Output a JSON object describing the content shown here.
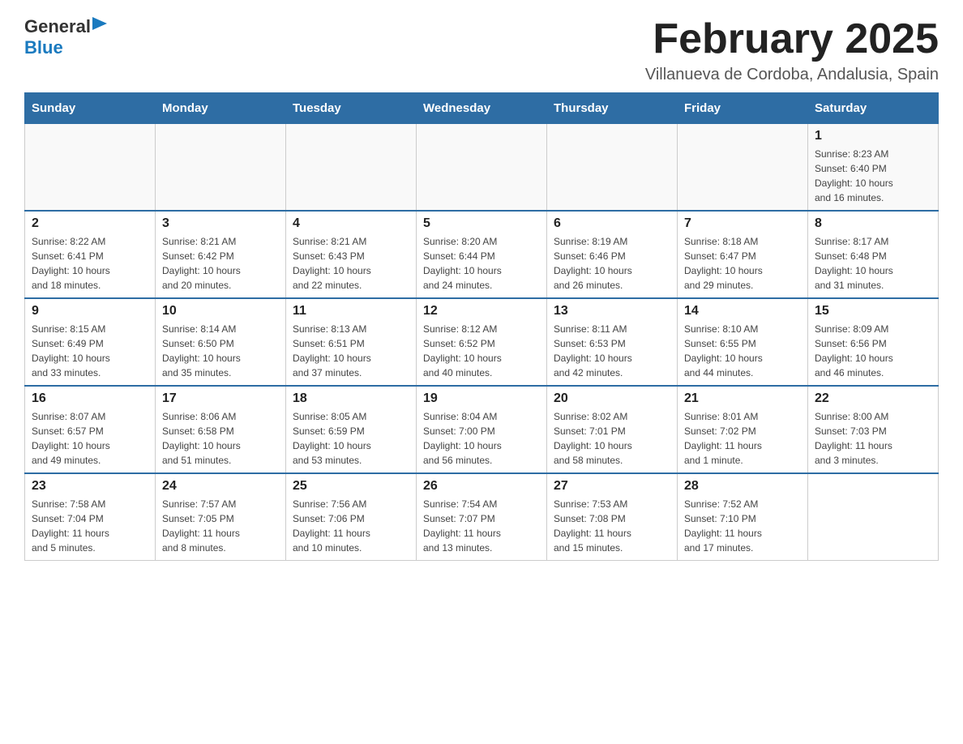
{
  "header": {
    "logo_general": "General",
    "logo_blue": "Blue",
    "title": "February 2025",
    "location": "Villanueva de Cordoba, Andalusia, Spain"
  },
  "days_of_week": [
    "Sunday",
    "Monday",
    "Tuesday",
    "Wednesday",
    "Thursday",
    "Friday",
    "Saturday"
  ],
  "weeks": [
    {
      "days": [
        {
          "num": "",
          "info": ""
        },
        {
          "num": "",
          "info": ""
        },
        {
          "num": "",
          "info": ""
        },
        {
          "num": "",
          "info": ""
        },
        {
          "num": "",
          "info": ""
        },
        {
          "num": "",
          "info": ""
        },
        {
          "num": "1",
          "info": "Sunrise: 8:23 AM\nSunset: 6:40 PM\nDaylight: 10 hours\nand 16 minutes."
        }
      ]
    },
    {
      "days": [
        {
          "num": "2",
          "info": "Sunrise: 8:22 AM\nSunset: 6:41 PM\nDaylight: 10 hours\nand 18 minutes."
        },
        {
          "num": "3",
          "info": "Sunrise: 8:21 AM\nSunset: 6:42 PM\nDaylight: 10 hours\nand 20 minutes."
        },
        {
          "num": "4",
          "info": "Sunrise: 8:21 AM\nSunset: 6:43 PM\nDaylight: 10 hours\nand 22 minutes."
        },
        {
          "num": "5",
          "info": "Sunrise: 8:20 AM\nSunset: 6:44 PM\nDaylight: 10 hours\nand 24 minutes."
        },
        {
          "num": "6",
          "info": "Sunrise: 8:19 AM\nSunset: 6:46 PM\nDaylight: 10 hours\nand 26 minutes."
        },
        {
          "num": "7",
          "info": "Sunrise: 8:18 AM\nSunset: 6:47 PM\nDaylight: 10 hours\nand 29 minutes."
        },
        {
          "num": "8",
          "info": "Sunrise: 8:17 AM\nSunset: 6:48 PM\nDaylight: 10 hours\nand 31 minutes."
        }
      ]
    },
    {
      "days": [
        {
          "num": "9",
          "info": "Sunrise: 8:15 AM\nSunset: 6:49 PM\nDaylight: 10 hours\nand 33 minutes."
        },
        {
          "num": "10",
          "info": "Sunrise: 8:14 AM\nSunset: 6:50 PM\nDaylight: 10 hours\nand 35 minutes."
        },
        {
          "num": "11",
          "info": "Sunrise: 8:13 AM\nSunset: 6:51 PM\nDaylight: 10 hours\nand 37 minutes."
        },
        {
          "num": "12",
          "info": "Sunrise: 8:12 AM\nSunset: 6:52 PM\nDaylight: 10 hours\nand 40 minutes."
        },
        {
          "num": "13",
          "info": "Sunrise: 8:11 AM\nSunset: 6:53 PM\nDaylight: 10 hours\nand 42 minutes."
        },
        {
          "num": "14",
          "info": "Sunrise: 8:10 AM\nSunset: 6:55 PM\nDaylight: 10 hours\nand 44 minutes."
        },
        {
          "num": "15",
          "info": "Sunrise: 8:09 AM\nSunset: 6:56 PM\nDaylight: 10 hours\nand 46 minutes."
        }
      ]
    },
    {
      "days": [
        {
          "num": "16",
          "info": "Sunrise: 8:07 AM\nSunset: 6:57 PM\nDaylight: 10 hours\nand 49 minutes."
        },
        {
          "num": "17",
          "info": "Sunrise: 8:06 AM\nSunset: 6:58 PM\nDaylight: 10 hours\nand 51 minutes."
        },
        {
          "num": "18",
          "info": "Sunrise: 8:05 AM\nSunset: 6:59 PM\nDaylight: 10 hours\nand 53 minutes."
        },
        {
          "num": "19",
          "info": "Sunrise: 8:04 AM\nSunset: 7:00 PM\nDaylight: 10 hours\nand 56 minutes."
        },
        {
          "num": "20",
          "info": "Sunrise: 8:02 AM\nSunset: 7:01 PM\nDaylight: 10 hours\nand 58 minutes."
        },
        {
          "num": "21",
          "info": "Sunrise: 8:01 AM\nSunset: 7:02 PM\nDaylight: 11 hours\nand 1 minute."
        },
        {
          "num": "22",
          "info": "Sunrise: 8:00 AM\nSunset: 7:03 PM\nDaylight: 11 hours\nand 3 minutes."
        }
      ]
    },
    {
      "days": [
        {
          "num": "23",
          "info": "Sunrise: 7:58 AM\nSunset: 7:04 PM\nDaylight: 11 hours\nand 5 minutes."
        },
        {
          "num": "24",
          "info": "Sunrise: 7:57 AM\nSunset: 7:05 PM\nDaylight: 11 hours\nand 8 minutes."
        },
        {
          "num": "25",
          "info": "Sunrise: 7:56 AM\nSunset: 7:06 PM\nDaylight: 11 hours\nand 10 minutes."
        },
        {
          "num": "26",
          "info": "Sunrise: 7:54 AM\nSunset: 7:07 PM\nDaylight: 11 hours\nand 13 minutes."
        },
        {
          "num": "27",
          "info": "Sunrise: 7:53 AM\nSunset: 7:08 PM\nDaylight: 11 hours\nand 15 minutes."
        },
        {
          "num": "28",
          "info": "Sunrise: 7:52 AM\nSunset: 7:10 PM\nDaylight: 11 hours\nand 17 minutes."
        },
        {
          "num": "",
          "info": ""
        }
      ]
    }
  ]
}
